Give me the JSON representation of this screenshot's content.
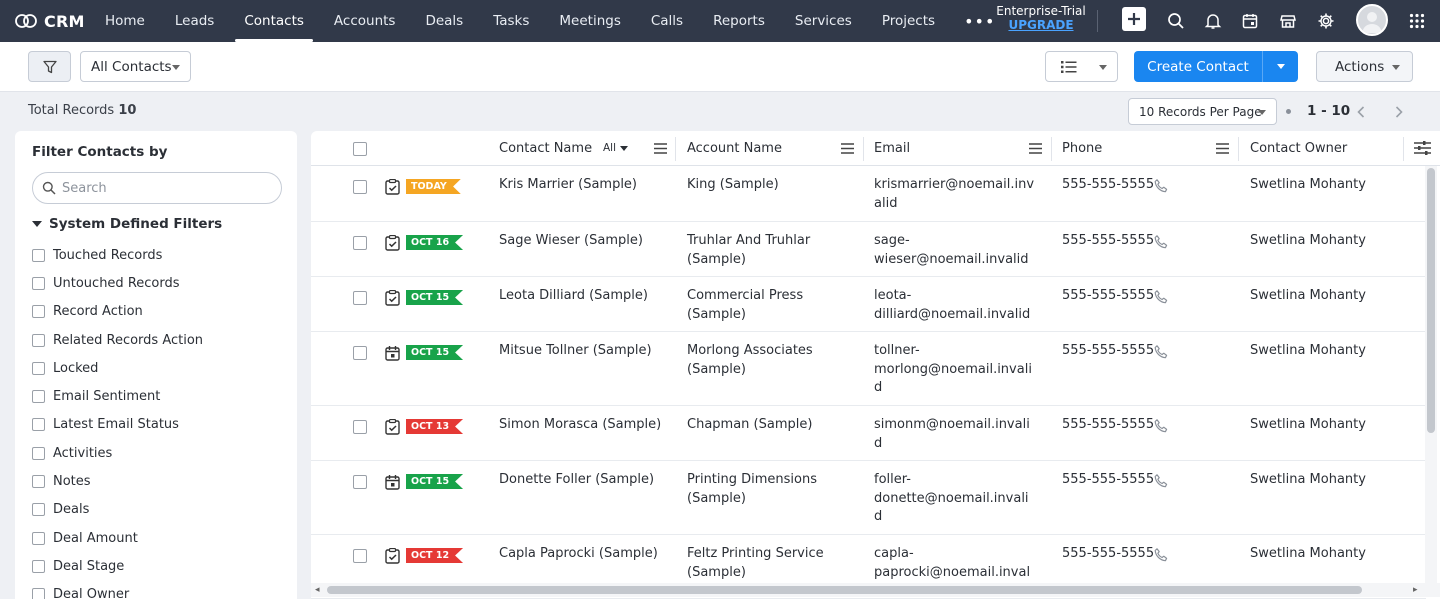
{
  "brand": {
    "name": "CRM"
  },
  "nav": {
    "items": [
      {
        "label": "Home",
        "active": false
      },
      {
        "label": "Leads",
        "active": false
      },
      {
        "label": "Contacts",
        "active": true
      },
      {
        "label": "Accounts",
        "active": false
      },
      {
        "label": "Deals",
        "active": false
      },
      {
        "label": "Tasks",
        "active": false
      },
      {
        "label": "Meetings",
        "active": false
      },
      {
        "label": "Calls",
        "active": false
      },
      {
        "label": "Reports",
        "active": false
      },
      {
        "label": "Services",
        "active": false
      },
      {
        "label": "Projects",
        "active": false
      }
    ],
    "more_label": "•••",
    "trial_label": "Enterprise-Trial",
    "upgrade_label": "UPGRADE",
    "icons": [
      "plus-icon",
      "search-icon",
      "bell-icon",
      "calendar-icon",
      "marketplace-icon",
      "gear-icon",
      "avatar",
      "apps-grid-icon"
    ]
  },
  "toolbar": {
    "view_label": "All Contacts",
    "create_label": "Create Contact",
    "actions_label": "Actions"
  },
  "records": {
    "total_label": "Total Records",
    "total_count": "10",
    "per_page_label": "10 Records Per Page",
    "range_label": "1 - 10"
  },
  "filter_panel": {
    "title": "Filter Contacts by",
    "search_placeholder": "Search",
    "section_title": "System Defined Filters",
    "items": [
      "Touched Records",
      "Untouched Records",
      "Record Action",
      "Related Records Action",
      "Locked",
      "Email Sentiment",
      "Latest Email Status",
      "Activities",
      "Notes",
      "Deals",
      "Deal Amount",
      "Deal Stage",
      "Deal Owner"
    ]
  },
  "table": {
    "columns": {
      "contact_name": "Contact Name",
      "contact_filter": "All",
      "account_name": "Account Name",
      "email": "Email",
      "phone": "Phone",
      "owner": "Contact Owner"
    },
    "rows": [
      {
        "tag": "TODAY",
        "tag_color": "#f5a623",
        "task_type": "task",
        "name": "Kris Marrier (Sample)",
        "account_1": "King (Sample)",
        "account_2": "",
        "email_1": "krismarrier@noemail.inv",
        "email_2": "alid",
        "email_3": "",
        "phone": "555-555-5555",
        "owner": "Swetlina Mohanty"
      },
      {
        "tag": "OCT 16",
        "tag_color": "#18a34a",
        "task_type": "task",
        "name": "Sage Wieser (Sample)",
        "account_1": "Truhlar And Truhlar",
        "account_2": "(Sample)",
        "email_1": "sage-",
        "email_2": "wieser@noemail.invalid",
        "email_3": "",
        "phone": "555-555-5555",
        "owner": "Swetlina Mohanty"
      },
      {
        "tag": "OCT 15",
        "tag_color": "#18a34a",
        "task_type": "task",
        "name": "Leota Dilliard (Sample)",
        "account_1": "Commercial Press (Sample)",
        "account_2": "",
        "email_1": "leota-",
        "email_2": "dilliard@noemail.invalid",
        "email_3": "",
        "phone": "555-555-5555",
        "owner": "Swetlina Mohanty"
      },
      {
        "tag": "OCT 15",
        "tag_color": "#18a34a",
        "task_type": "meeting",
        "name": "Mitsue Tollner (Sample)",
        "account_1": "Morlong Associates",
        "account_2": "(Sample)",
        "email_1": "tollner-",
        "email_2": "morlong@noemail.invali",
        "email_3": "d",
        "phone": "555-555-5555",
        "owner": "Swetlina Mohanty"
      },
      {
        "tag": "OCT 13",
        "tag_color": "#e53935",
        "task_type": "task",
        "name": "Simon Morasca (Sample)",
        "account_1": "Chapman (Sample)",
        "account_2": "",
        "email_1": "simonm@noemail.invali",
        "email_2": "d",
        "email_3": "",
        "phone": "555-555-5555",
        "owner": "Swetlina Mohanty"
      },
      {
        "tag": "OCT 15",
        "tag_color": "#18a34a",
        "task_type": "meeting",
        "name": "Donette Foller (Sample)",
        "account_1": "Printing Dimensions",
        "account_2": "(Sample)",
        "email_1": "foller-",
        "email_2": "donette@noemail.invali",
        "email_3": "d",
        "phone": "555-555-5555",
        "owner": "Swetlina Mohanty"
      },
      {
        "tag": "OCT 12",
        "tag_color": "#e53935",
        "task_type": "task",
        "name": "Capla Paprocki (Sample)",
        "account_1": "Feltz Printing Service",
        "account_2": "(Sample)",
        "email_1": "capla-",
        "email_2": "paprocki@noemail.inval",
        "email_3": "",
        "phone": "555-555-5555",
        "owner": "Swetlina Mohanty"
      }
    ]
  },
  "colors": {
    "topbar": "#313949",
    "accent": "#1a86f0",
    "upgrade": "#4aa3ff",
    "tag_green": "#18a34a",
    "tag_red": "#e53935",
    "tag_orange": "#f5a623"
  }
}
